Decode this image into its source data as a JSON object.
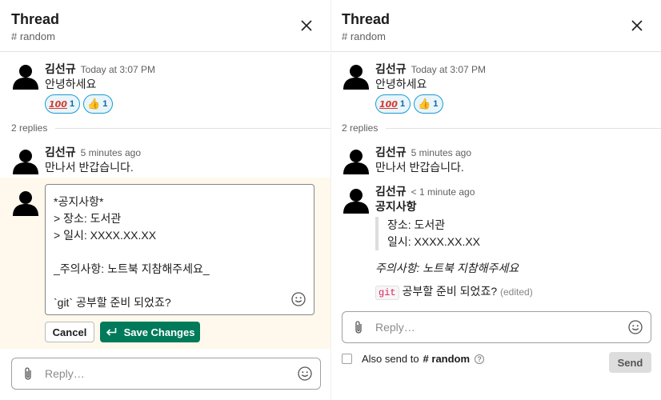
{
  "left": {
    "header": {
      "title": "Thread",
      "channel": "# random"
    },
    "parent": {
      "author": "김선규",
      "time": "Today at 3:07 PM",
      "text": "안녕하세요",
      "reactions": [
        {
          "emoji": "100",
          "count": "1"
        },
        {
          "emoji": "👍",
          "count": "1"
        }
      ]
    },
    "replies_label": "2 replies",
    "reply1": {
      "author": "김선규",
      "time": "5 minutes ago",
      "text": "만나서 반갑습니다."
    },
    "editor": {
      "lines": [
        "*공지사항*",
        "> 장소: 도서관",
        "> 일시: XXXX.XX.XX",
        "",
        "_주의사항: 노트북 지참해주세요_",
        "",
        "`git` 공부할 준비 되었죠?"
      ],
      "cancel_label": "Cancel",
      "save_label": "Save Changes"
    },
    "reply_input": {
      "placeholder": "Reply…"
    }
  },
  "right": {
    "header": {
      "title": "Thread",
      "channel": "# random"
    },
    "parent": {
      "author": "김선규",
      "time": "Today at 3:07 PM",
      "text": "안녕하세요",
      "reactions": [
        {
          "emoji": "100",
          "count": "1"
        },
        {
          "emoji": "👍",
          "count": "1"
        }
      ]
    },
    "replies_label": "2 replies",
    "reply1": {
      "author": "김선규",
      "time": "5 minutes ago",
      "text": "만나서 반갑습니다."
    },
    "reply2": {
      "author": "김선규",
      "time": "< 1 minute ago",
      "title": "공지사항",
      "quote": [
        "장소: 도서관",
        "일시: XXXX.XX.XX"
      ],
      "italic_note": "주의사항: 노트북 지참해주세요",
      "code": "git",
      "text_after_code": " 공부할 준비 되었죠?",
      "edited": "(edited)"
    },
    "reply_input": {
      "placeholder": "Reply…"
    },
    "also_send": {
      "label": "Also send to",
      "channel": "# random"
    },
    "send_label": "Send"
  },
  "colors": {
    "save_button": "#007a5a",
    "edit_highlight": "#fef9ec",
    "reaction_border": "#1d9bd1",
    "code_text": "#e01e5a"
  },
  "icons": {
    "close": "close-icon",
    "attach": "paperclip-icon",
    "emoji": "smiley-icon",
    "avatar": "person-avatar",
    "enter": "enter-arrow-icon",
    "help": "question-icon"
  }
}
